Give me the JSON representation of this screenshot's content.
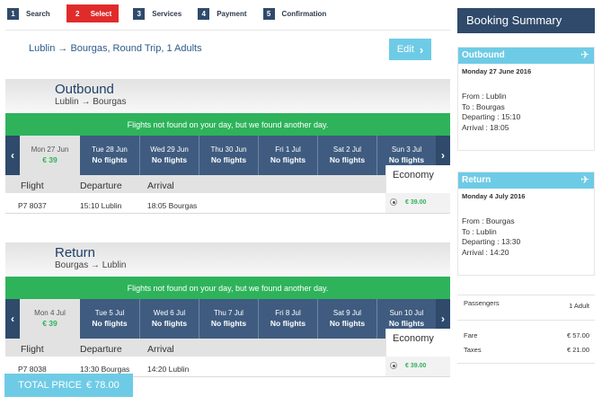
{
  "steps": [
    {
      "num": "1",
      "label": "Search"
    },
    {
      "num": "2",
      "label": "Select"
    },
    {
      "num": "3",
      "label": "Services"
    },
    {
      "num": "4",
      "label": "Payment"
    },
    {
      "num": "5",
      "label": "Confirmation"
    }
  ],
  "trip": {
    "summary": "Lublin → Bourgas, Round Trip, 1 Adults",
    "edit_label": "Edit",
    "edit_icon": "chevron-right-icon"
  },
  "notice": "Flights not found on your day, but we found another day.",
  "columns": {
    "flight": "Flight",
    "departure": "Departure",
    "arrival": "Arrival",
    "class": "Economy"
  },
  "outbound": {
    "title": "Outbound",
    "route": "Lublin → Bourgas",
    "dates": [
      {
        "day": "Mon 27 Jun",
        "price": "€ 39"
      },
      {
        "day": "Tue 28 Jun",
        "price": "No flights"
      },
      {
        "day": "Wed 29 Jun",
        "price": "No flights"
      },
      {
        "day": "Thu 30 Jun",
        "price": "No flights"
      },
      {
        "day": "Fri 1 Jul",
        "price": "No flights"
      },
      {
        "day": "Sat 2 Jul",
        "price": "No flights"
      },
      {
        "day": "Sun 3 Jul",
        "price": "No flights"
      }
    ],
    "flight": {
      "number": "P7 8037",
      "departure": "15:10 Lublin",
      "arrival": "18:05 Bourgas",
      "fare": "€ 39.00"
    }
  },
  "return": {
    "title": "Return",
    "route": "Bourgas → Lublin",
    "dates": [
      {
        "day": "Mon 4 Jul",
        "price": "€ 39"
      },
      {
        "day": "Tue 5 Jul",
        "price": "No flights"
      },
      {
        "day": "Wed 6 Jul",
        "price": "No flights"
      },
      {
        "day": "Thu 7 Jul",
        "price": "No flights"
      },
      {
        "day": "Fri 8 Jul",
        "price": "No flights"
      },
      {
        "day": "Sat 9 Jul",
        "price": "No flights"
      },
      {
        "day": "Sun 10 Jul",
        "price": "No flights"
      }
    ],
    "flight": {
      "number": "P7 8038",
      "departure": "13:30 Bourgas",
      "arrival": "14:20 Lublin",
      "fare": "€ 39.00"
    }
  },
  "sidebar": {
    "title": "Booking Summary",
    "outbound": {
      "label": "Outbound",
      "date": "Monday 27 June 2016",
      "from": "From : Lublin",
      "to": "To : Bourgas",
      "departing": "Departing : 15:10",
      "arrival": "Arrival : 18:05"
    },
    "return": {
      "label": "Return",
      "date": "Monday 4 July 2016",
      "from": "From : Bourgas",
      "to": "To : Lublin",
      "departing": "Departing : 13:30",
      "arrival": "Arrival : 14:20"
    },
    "passengers_label": "Passengers",
    "passengers_value": "1 Adult",
    "fare_label": "Fare",
    "fare_value": "€ 57.00",
    "taxes_label": "Taxes",
    "taxes_value": "€ 21.00",
    "total_label": "TOTAL PRICE",
    "total_value": "€ 78.00"
  },
  "colors": {
    "navy": "#2f4a6b",
    "active_step": "#e02b2b",
    "notice_green": "#2eb35b",
    "light_blue": "#6ecbe6"
  }
}
